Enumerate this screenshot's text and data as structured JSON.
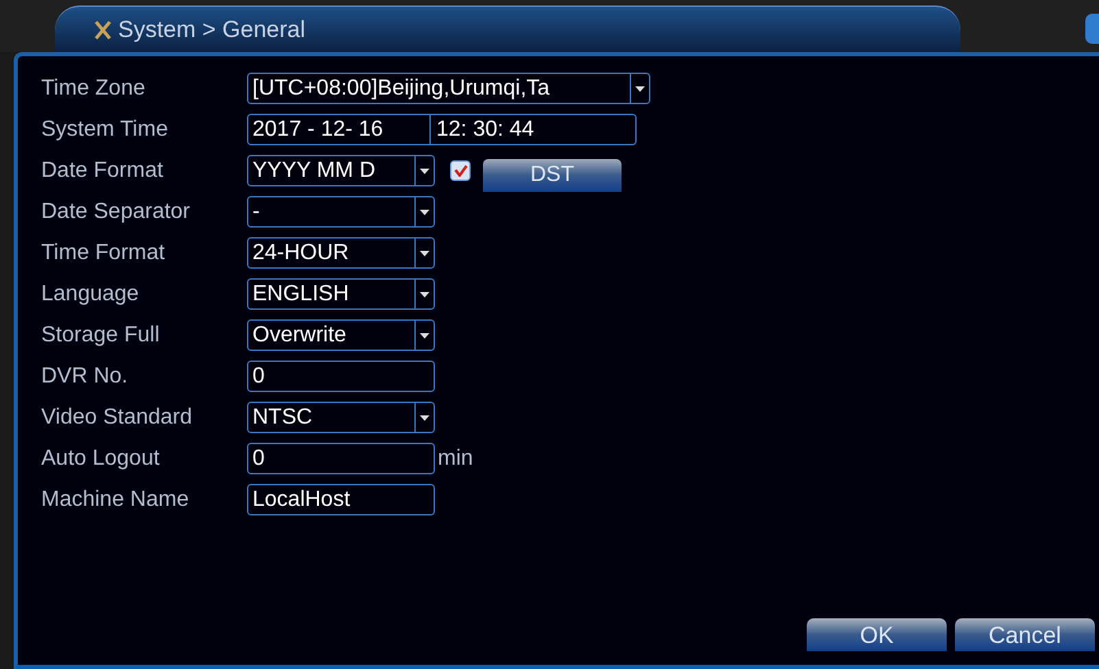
{
  "window": {
    "title": "System > General"
  },
  "rows": [
    {
      "label": "Time Zone",
      "kind": "dropdown",
      "value": "[UTC+08:00]Beijing,Urumqi,Ta",
      "wide": true
    },
    {
      "label": "System Time",
      "kind": "datetime",
      "date": "2017 - 12- 16",
      "time": "12: 30: 44"
    },
    {
      "label": "Date Format",
      "kind": "dropdown",
      "value": "YYYY MM D",
      "dst": {
        "checked": true,
        "button": "DST"
      }
    },
    {
      "label": "Date Separator",
      "kind": "dropdown",
      "value": "-"
    },
    {
      "label": "Time Format",
      "kind": "dropdown",
      "value": "24-HOUR"
    },
    {
      "label": "Language",
      "kind": "dropdown",
      "value": "ENGLISH"
    },
    {
      "label": "Storage Full",
      "kind": "dropdown",
      "value": "Overwrite"
    },
    {
      "label": "DVR No.",
      "kind": "text",
      "value": "0"
    },
    {
      "label": "Video Standard",
      "kind": "dropdown",
      "value": "NTSC"
    },
    {
      "label": "Auto Logout",
      "kind": "text",
      "value": "0",
      "unit": "min"
    },
    {
      "label": "Machine Name",
      "kind": "text",
      "value": "LocalHost"
    }
  ],
  "buttons": [
    "OK",
    "Cancel"
  ]
}
